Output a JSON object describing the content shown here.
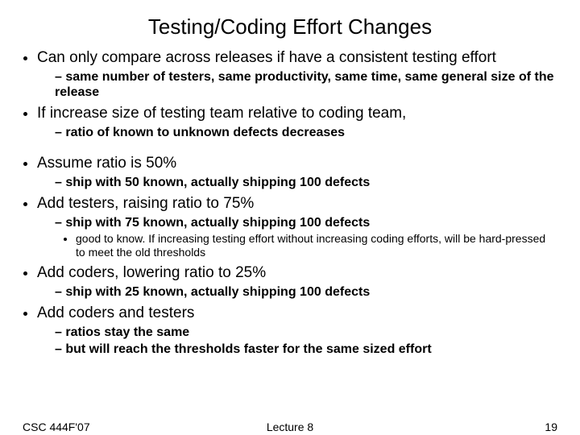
{
  "title": "Testing/Coding Effort Changes",
  "bullets": [
    {
      "text": "Can only compare across releases if have a consistent testing effort",
      "sub": [
        {
          "text": "same number of testers, same productivity, same time, same general size of the release"
        }
      ]
    },
    {
      "text": "If increase size of testing team relative to coding team,",
      "sub": [
        {
          "text": "ratio of known to unknown defects decreases"
        }
      ],
      "spacerAfter": true
    },
    {
      "text": "Assume ratio is 50%",
      "sub": [
        {
          "text": "ship with 50 known, actually shipping 100 defects"
        }
      ]
    },
    {
      "text": "Add testers, raising ratio to 75%",
      "sub": [
        {
          "text": "ship with 75 known, actually shipping 100 defects",
          "sub": [
            {
              "text": "good to know. If increasing testing effort without increasing coding efforts, will be hard-pressed to meet the old thresholds"
            }
          ]
        }
      ]
    },
    {
      "text": "Add coders, lowering ratio to 25%",
      "sub": [
        {
          "text": "ship with 25 known, actually shipping 100 defects"
        }
      ]
    },
    {
      "text": "Add coders and testers",
      "sub": [
        {
          "text": "ratios stay the same"
        },
        {
          "text": "but will reach the thresholds faster for the same sized effort"
        }
      ]
    }
  ],
  "footer": {
    "left": "CSC 444F'07",
    "center": "Lecture 8",
    "right": "19"
  }
}
